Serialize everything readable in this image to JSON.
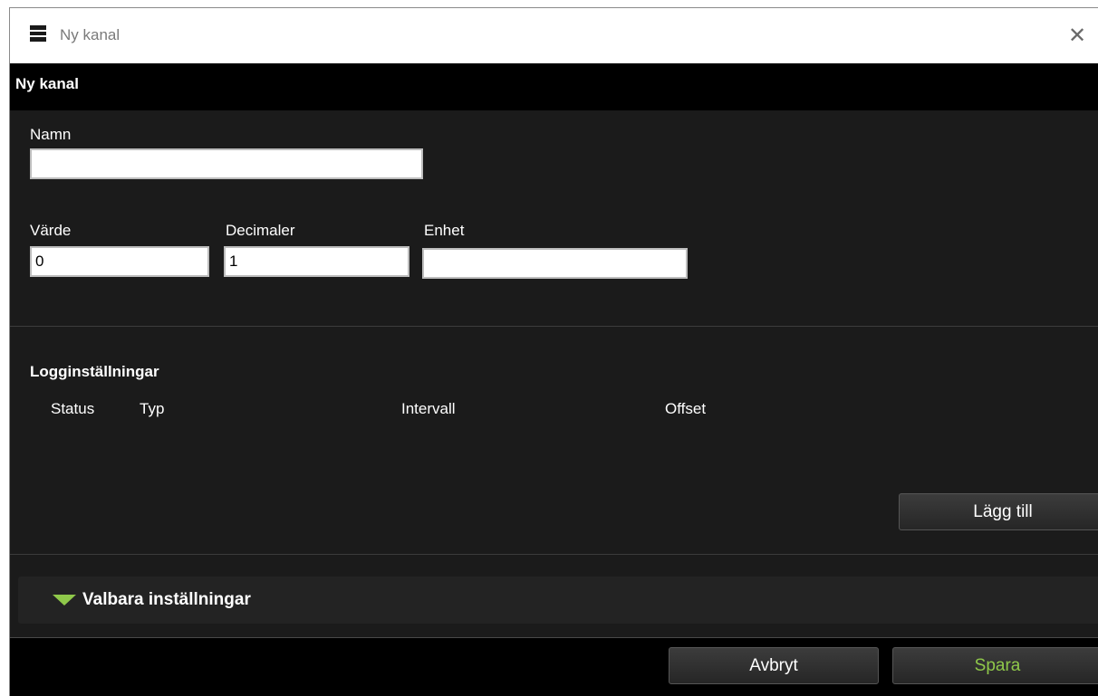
{
  "window": {
    "title": "Ny kanal"
  },
  "header": {
    "title": "Ny kanal"
  },
  "form": {
    "name_label": "Namn",
    "name_value": "",
    "value_label": "Värde",
    "value_value": "0",
    "decimals_label": "Decimaler",
    "decimals_value": "1",
    "unit_label": "Enhet",
    "unit_value": ""
  },
  "logging": {
    "title": "Logginställningar",
    "columns": [
      "Status",
      "Typ",
      "Intervall",
      "Offset"
    ],
    "add_button": "Lägg till"
  },
  "optional": {
    "label": "Valbara inställningar"
  },
  "footer": {
    "cancel_label": "Avbryt",
    "save_label": "Spara"
  },
  "colors": {
    "accent": "#8fc84a",
    "background": "#1b1b1b",
    "header": "#000000"
  }
}
